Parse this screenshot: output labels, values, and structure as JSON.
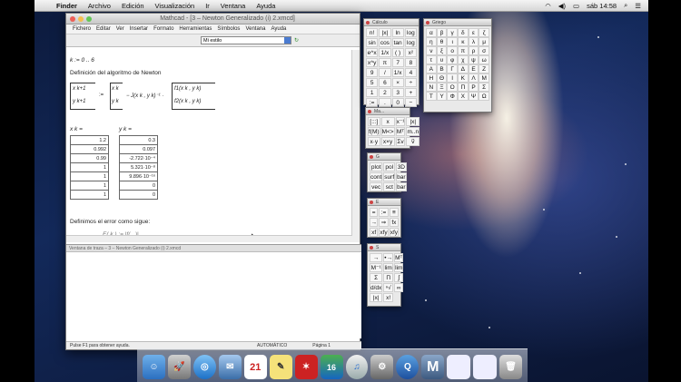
{
  "menubar": {
    "app": "Finder",
    "items": [
      "Archivo",
      "Edición",
      "Visualización",
      "Ir",
      "Ventana",
      "Ayuda"
    ],
    "clock": "sáb 14:58"
  },
  "main_window": {
    "title": "Mathcad - [3 – Newton Generalizado (i) 2.xmcd]",
    "menu": [
      "Fichero",
      "Editar",
      "Ver",
      "Insertar",
      "Formato",
      "Herramientas",
      "Símbolos",
      "Ventana",
      "Ayuda"
    ],
    "style_select": "Mi estilo",
    "doc": {
      "k_def": "k := 0 .. 6",
      "heading": "Definición del algoritmo de Newton",
      "formula_lhs_top": "x k+1",
      "formula_lhs_bot": "y k+1",
      "formula_eq": ":=",
      "formula_rhs_top": "x k",
      "formula_rhs_bot": "y k",
      "formula_jac": "− J(x k , y k)⁻¹ ·",
      "formula_f_top": "f1(x k , y k)",
      "formula_f_bot": "f2(x k , y k)",
      "xk_label": "x k =",
      "yk_label": "y k =",
      "xk_values": [
        "1.2",
        "0.992",
        "0.99",
        "1",
        "1",
        "1",
        "1"
      ],
      "yk_values": [
        "0.3",
        "0.097",
        "-2.722·10⁻⁴",
        "5.321·10⁻⁸",
        "9.896·10⁻¹⁶",
        "0",
        "0"
      ],
      "error_text": "Definimos el error como sigue:",
      "error_formula": "E( k ) := |f(...)|"
    },
    "trace_title": "Ventana de traza – 3 – Newton Generalizado (i) 2.xmcd",
    "status": {
      "help": "Pulse F1 para obtener ayuda.",
      "mode": "AUTOMÁTICO",
      "page": "Página 1"
    }
  },
  "palettes": {
    "calc_title": "Cálculo",
    "calc_keys": [
      "n!",
      "|x|",
      "ln",
      "log",
      "sin",
      "cos",
      "tan",
      "log",
      "e^x",
      "1/x",
      "( )",
      "x²",
      "x^y",
      "π",
      "7",
      "8",
      "9",
      "/",
      "1/x",
      "4",
      "5",
      "6",
      "×",
      "÷",
      "1",
      "2",
      "3",
      "+",
      ":=",
      ".",
      "0",
      "−",
      "="
    ],
    "greek_title": "Griego",
    "greek_keys": [
      "α",
      "β",
      "γ",
      "δ",
      "ε",
      "ζ",
      "η",
      "θ",
      "ι",
      "κ",
      "λ",
      "μ",
      "ν",
      "ξ",
      "ο",
      "π",
      "ρ",
      "σ",
      "τ",
      "υ",
      "φ",
      "χ",
      "ψ",
      "ω",
      "Α",
      "Β",
      "Γ",
      "Δ",
      "Ε",
      "Ζ",
      "Η",
      "Θ",
      "Ι",
      "Κ",
      "Λ",
      "Μ",
      "Ν",
      "Ξ",
      "Ο",
      "Π",
      "Ρ",
      "Σ",
      "Τ",
      "Υ",
      "Φ",
      "Χ",
      "Ψ",
      "Ω"
    ],
    "matrix_title": "Ma...",
    "matrix_keys": [
      "[:::]",
      "x",
      "x⁻¹",
      "|x|",
      "f(M)",
      "M<>",
      "Mᵀ",
      "m..n",
      "x·y",
      "x×y",
      "Σv",
      "v⃗"
    ],
    "graph_title": "G",
    "graph_keys": [
      "plot",
      "pol",
      "3D",
      "cont",
      "surf",
      "bar",
      "vec",
      "sct",
      "bar"
    ],
    "eval_title": "E",
    "eval_keys": [
      "=",
      ":=",
      "≡",
      "→",
      "⇒",
      "fx",
      "xf",
      "xfy",
      "xfy"
    ],
    "symb_title": "S",
    "symb_keys": [
      "→",
      "•→",
      "Mᵀ",
      "M⁻¹",
      "lim",
      "lim",
      "Σ",
      "Π",
      "∫",
      "d/dx",
      "ⁿ√",
      "∞",
      "|x|",
      "x!"
    ]
  },
  "dock": {
    "calendar_day": "21",
    "badge": "16"
  }
}
